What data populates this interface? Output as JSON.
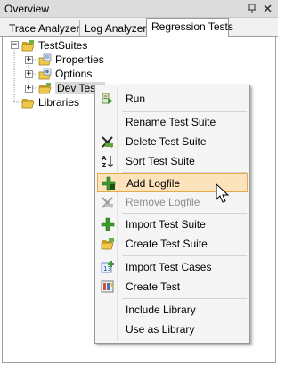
{
  "window": {
    "title": "Overview",
    "pin_icon": "pin-icon",
    "close_icon": "close-icon"
  },
  "tabs": [
    {
      "label": "Trace Analyzer",
      "active": false
    },
    {
      "label": "Log Analyzer",
      "active": false
    },
    {
      "label": "Regression Tests",
      "active": true
    }
  ],
  "tree": {
    "root": {
      "label": "TestSuites",
      "icon": "folder-open-icon",
      "expanded": true
    },
    "children": [
      {
        "label": "Properties",
        "icon": "properties-icon",
        "expanded": false
      },
      {
        "label": "Options",
        "icon": "options-icon",
        "expanded": false
      },
      {
        "label": "Dev Tests",
        "icon": "folder-open-icon",
        "expanded": false
      }
    ],
    "libraries": {
      "label": "Libraries",
      "icon": "folder-open-icon"
    }
  },
  "context_menu": {
    "items": [
      {
        "label": "Run",
        "icon": "run-icon",
        "enabled": true
      },
      {
        "separator": true
      },
      {
        "label": "Rename Test Suite",
        "icon": "",
        "enabled": true
      },
      {
        "label": "Delete Test Suite",
        "icon": "delete-icon",
        "enabled": true
      },
      {
        "label": "Sort Test Suite",
        "icon": "sort-az-icon",
        "enabled": true
      },
      {
        "separator": true
      },
      {
        "label": "Add Logfile",
        "icon": "add-icon",
        "enabled": true,
        "hovered": true
      },
      {
        "label": "Remove Logfile",
        "icon": "remove-icon",
        "enabled": false
      },
      {
        "separator": true
      },
      {
        "label": "Import Test Suite",
        "icon": "add-icon",
        "enabled": true
      },
      {
        "label": "Create Test Suite",
        "icon": "folder-open-icon",
        "enabled": true
      },
      {
        "separator": true
      },
      {
        "label": "Import Test Cases",
        "icon": "import-cases-icon",
        "enabled": true
      },
      {
        "label": "Create Test",
        "icon": "create-test-icon",
        "enabled": true
      },
      {
        "separator": true
      },
      {
        "label": "Include Library",
        "icon": "",
        "enabled": true
      },
      {
        "label": "Use as Library",
        "icon": "",
        "enabled": true
      }
    ]
  },
  "colors": {
    "hover_bg": "#fce3bb",
    "hover_border": "#e3a94a",
    "menu_bg": "#f5f5f5",
    "titlebar_bg": "#dcdcdc"
  }
}
